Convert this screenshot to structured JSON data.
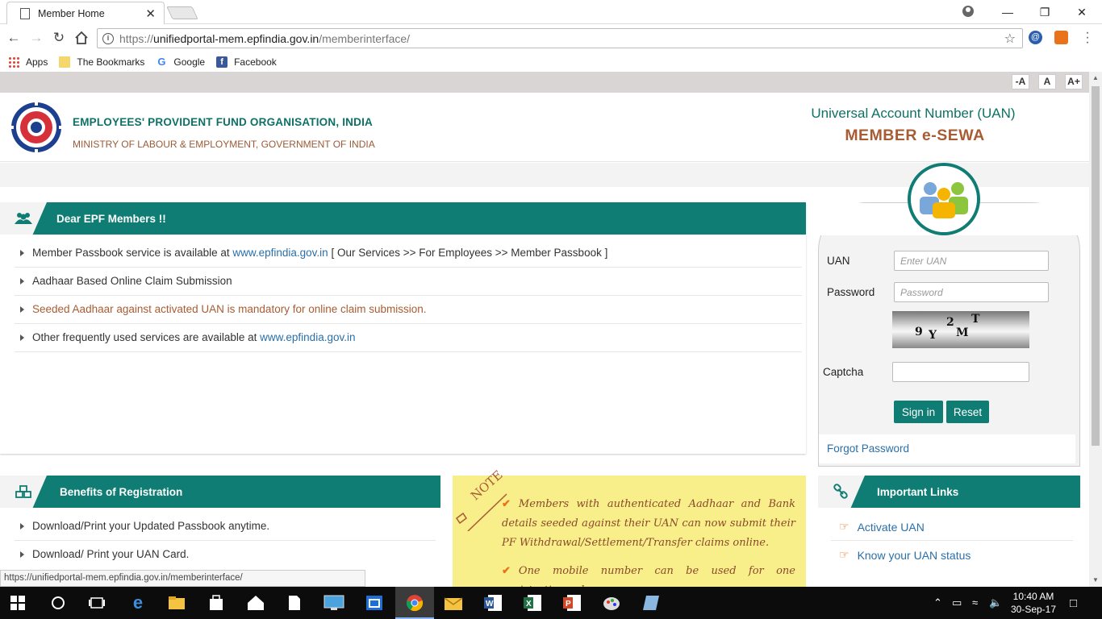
{
  "browser": {
    "tab_title": "Member Home",
    "tab_close": "✕",
    "url_prefix": "https://",
    "url_host": "unifiedportal-mem.epfindia.gov.in",
    "url_path": "/memberinterface/",
    "bookmarks": [
      {
        "label": "Apps"
      },
      {
        "label": "The Bookmarks"
      },
      {
        "label": "Google"
      },
      {
        "label": "Facebook"
      }
    ],
    "status_url": "https://unifiedportal-mem.epfindia.gov.in/memberinterface/"
  },
  "font_controls": [
    "-A",
    "A",
    "A+"
  ],
  "header": {
    "org_name": "EMPLOYEES' PROVIDENT FUND ORGANISATION, INDIA",
    "ministry": "MINISTRY OF LABOUR & EMPLOYMENT, GOVERNMENT OF INDIA",
    "uan_title": "Universal Account Number (UAN)",
    "esewa": "MEMBER e-SEWA"
  },
  "dear_members": {
    "title": "Dear EPF Members !!",
    "item1_pre": "Member Passbook service is available at ",
    "item1_link": "www.epfindia.gov.in",
    "item1_post": " [ Our Services >> For Employees >> Member Passbook ]",
    "item2": "Aadhaar Based Online Claim Submission",
    "item3": "Seeded Aadhaar against activated UAN is mandatory for online claim submission.",
    "item4_pre": "Other frequently used services are available at ",
    "item4_link": "www.epfindia.gov.in"
  },
  "login": {
    "uan_label": "UAN",
    "uan_placeholder": "Enter UAN",
    "password_label": "Password",
    "password_placeholder": "Password",
    "captcha_chars": [
      "9",
      "Y",
      "2",
      "M",
      "T"
    ],
    "captcha_label": "Captcha",
    "signin": "Sign in",
    "reset": "Reset",
    "forgot": "Forgot Password"
  },
  "benefits": {
    "title": "Benefits of Registration",
    "items": [
      "Download/Print your Updated Passbook anytime.",
      "Download/ Print your UAN Card."
    ]
  },
  "note": {
    "stamp": "NOTE",
    "line1": "Members with authenticated Aadhaar and Bank details seeded against their UAN can now submit their PF Withdrawal/Settlement/Transfer claims online.",
    "line2": "One mobile number can be used for one registration only."
  },
  "important_links": {
    "title": "Important Links",
    "items": [
      "Activate UAN",
      "Know your UAN status"
    ]
  },
  "taskbar": {
    "time": "10:40 AM",
    "date": "30-Sep-17"
  },
  "colors": {
    "teal": "#0f7d73",
    "rust": "#a85c33",
    "link": "#2a6fa8",
    "note_bg": "#f8ee8a"
  }
}
